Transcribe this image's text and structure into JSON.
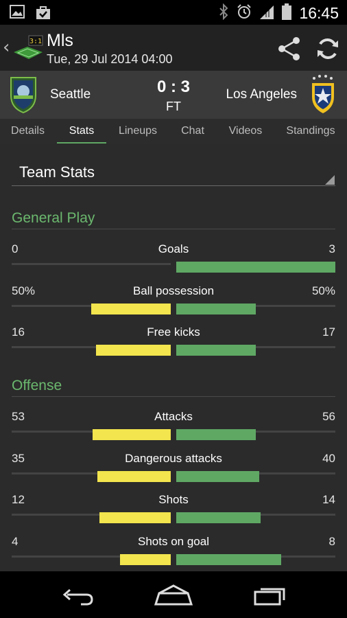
{
  "status_bar": {
    "time": "16:45",
    "left_icons": [
      "image-icon",
      "shopping-bag-icon"
    ],
    "right_icons": [
      "bluetooth-icon",
      "alarm-icon",
      "signal-icon",
      "battery-icon"
    ]
  },
  "app_bar": {
    "title": "Mls",
    "subtitle": "Tue, 29 Jul 2014 04:00",
    "logo_text": "3:1",
    "actions": [
      "share-icon",
      "refresh-icon"
    ]
  },
  "match": {
    "home_team": "Seattle",
    "away_team": "Los Angeles",
    "score": "0 : 3",
    "status": "FT"
  },
  "tabs": [
    {
      "label": "Details",
      "active": false
    },
    {
      "label": "Stats",
      "active": true
    },
    {
      "label": "Lineups",
      "active": false
    },
    {
      "label": "Chat",
      "active": false
    },
    {
      "label": "Videos",
      "active": false
    },
    {
      "label": "Standings",
      "active": false
    }
  ],
  "dropdown": {
    "label": "Team Stats"
  },
  "colors": {
    "accent": "#5fa864",
    "home_bar": "#f2e54e",
    "away_bar": "#5fa864"
  },
  "sections": [
    {
      "title": "General Play",
      "stats": [
        {
          "name": "Goals",
          "left": "0",
          "right": "3",
          "left_frac": 0.0,
          "right_frac": 1.0
        },
        {
          "name": "Ball possession",
          "left": "50%",
          "right": "50%",
          "left_frac": 0.5,
          "right_frac": 0.5
        },
        {
          "name": "Free kicks",
          "left": "16",
          "right": "17",
          "left_frac": 0.47,
          "right_frac": 0.5
        }
      ]
    },
    {
      "title": "Offense",
      "stats": [
        {
          "name": "Attacks",
          "left": "53",
          "right": "56",
          "left_frac": 0.49,
          "right_frac": 0.5
        },
        {
          "name": "Dangerous attacks",
          "left": "35",
          "right": "40",
          "left_frac": 0.46,
          "right_frac": 0.52
        },
        {
          "name": "Shots",
          "left": "12",
          "right": "14",
          "left_frac": 0.45,
          "right_frac": 0.53
        },
        {
          "name": "Shots on goal",
          "left": "4",
          "right": "8",
          "left_frac": 0.32,
          "right_frac": 0.66
        }
      ]
    }
  ],
  "nav": [
    "back-icon",
    "home-icon",
    "recents-icon"
  ]
}
